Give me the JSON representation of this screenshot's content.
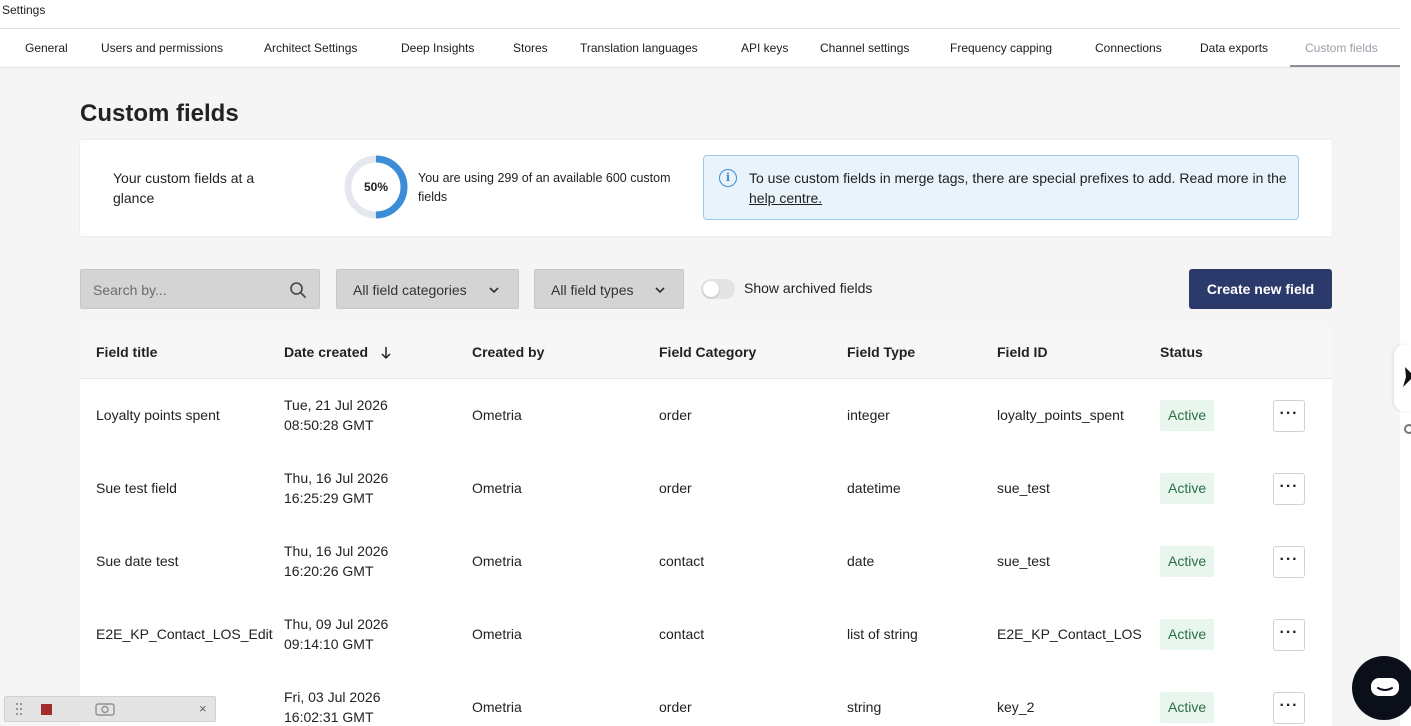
{
  "window": {
    "title": "Settings"
  },
  "tabs": [
    {
      "label": "General"
    },
    {
      "label": "Users and permissions"
    },
    {
      "label": "Architect Settings"
    },
    {
      "label": "Deep Insights"
    },
    {
      "label": "Stores"
    },
    {
      "label": "Translation languages"
    },
    {
      "label": "API keys"
    },
    {
      "label": "Channel settings"
    },
    {
      "label": "Frequency capping"
    },
    {
      "label": "Connections"
    },
    {
      "label": "Data exports"
    },
    {
      "label": "Custom fields",
      "active": true
    }
  ],
  "page": {
    "title": "Custom fields"
  },
  "glance": {
    "label": "Your custom fields at a glance",
    "percent_label": "50%",
    "usage_fraction": 0.5,
    "usage_text": "You are using 299 of an available 600 custom fields",
    "info_text": "To use custom fields in merge tags, there are special prefixes to add. Read more in the",
    "info_link": "help centre."
  },
  "filters": {
    "search_placeholder": "Search by...",
    "category_select": "All field categories",
    "type_select": "All field types",
    "archived_toggle_label": "Show archived fields",
    "archived_toggle_on": false,
    "create_button": "Create new field"
  },
  "table": {
    "columns": [
      "Field title",
      "Date created",
      "Created by",
      "Field Category",
      "Field Type",
      "Field ID",
      "Status"
    ],
    "sort_column": "Date created",
    "rows": [
      {
        "title": "Loyalty points spent",
        "date": "Tue, 21 Jul 2026",
        "time": "08:50:28 GMT",
        "created_by": "Ometria",
        "category": "order",
        "type": "integer",
        "field_id": "loyalty_points_spent",
        "status": "Active"
      },
      {
        "title": "Sue test field",
        "date": "Thu, 16 Jul 2026",
        "time": "16:25:29 GMT",
        "created_by": "Ometria",
        "category": "order",
        "type": "datetime",
        "field_id": "sue_test",
        "status": "Active"
      },
      {
        "title": "Sue date test",
        "date": "Thu, 16 Jul 2026",
        "time": "16:20:26 GMT",
        "created_by": "Ometria",
        "category": "contact",
        "type": "date",
        "field_id": "sue_test",
        "status": "Active"
      },
      {
        "title": "E2E_KP_Contact_LOS_Edit",
        "date": "Thu, 09 Jul 2026",
        "time": "09:14:10 GMT",
        "created_by": "Ometria",
        "category": "contact",
        "type": "list of string",
        "field_id": "E2E_KP_Contact_LOS",
        "status": "Active"
      },
      {
        "title": "",
        "date": "Fri, 03 Jul 2026",
        "time": "16:02:31 GMT",
        "created_by": "Ometria",
        "category": "order",
        "type": "string",
        "field_id": "key_2",
        "status": "Active"
      }
    ],
    "row_action_label": "···"
  },
  "recorder": {
    "close_label": "×"
  },
  "colors": {
    "primary_button": "#2c3a6b",
    "donut_fill": "#3a8dd6",
    "info_bg": "#e8f3fb",
    "status_bg": "#e9f6ee"
  }
}
